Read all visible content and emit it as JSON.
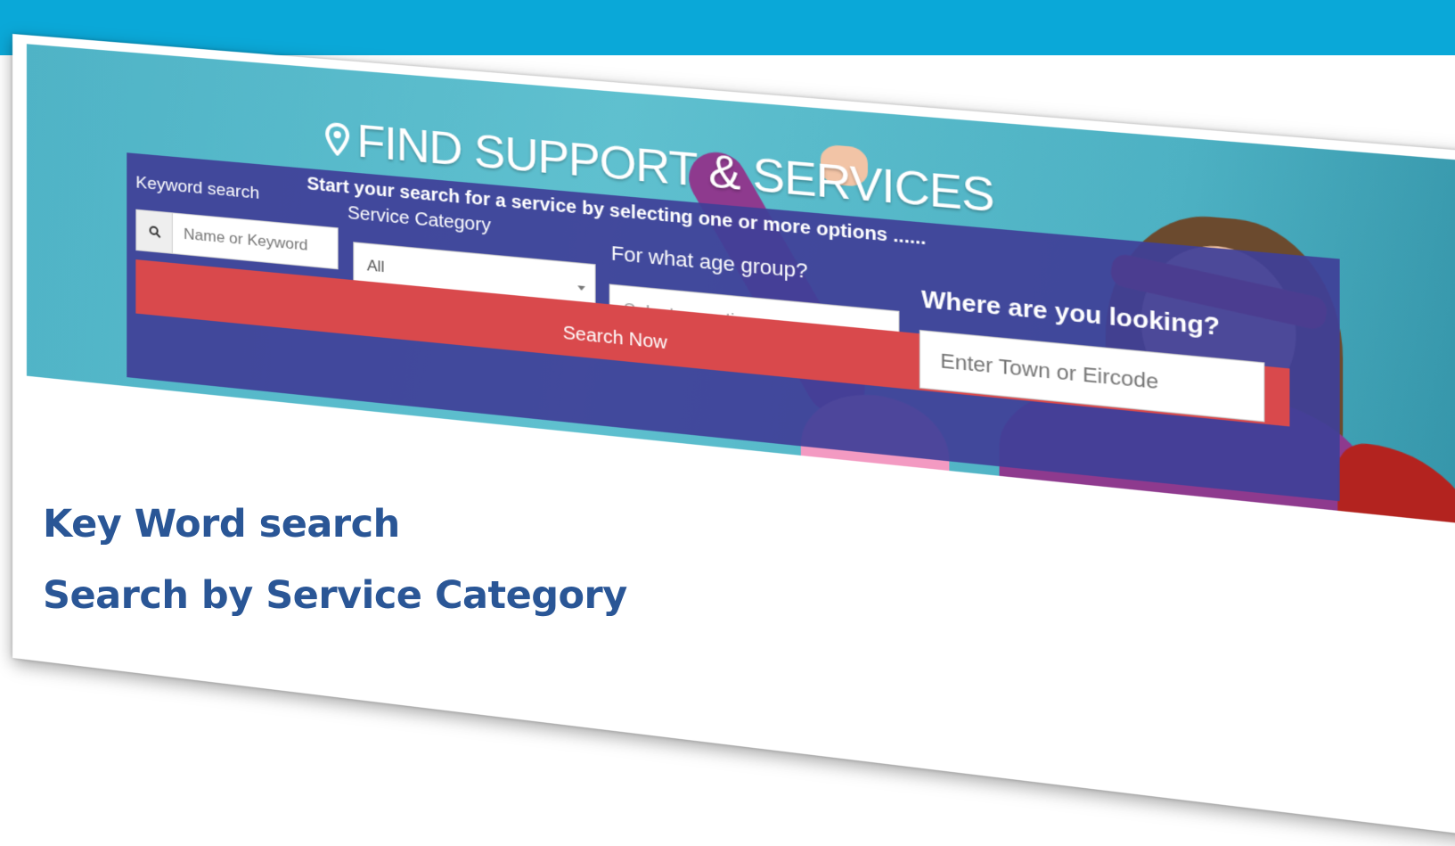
{
  "banner": {
    "title": "FIND SUPPORT & SERVICES",
    "pin_icon": "map-pin-icon"
  },
  "search": {
    "intro": "Start your search for a service by selecting one or more options ......",
    "keyword_label": "Keyword search",
    "keyword_placeholder": "Name or Keyword",
    "keyword_icon": "search-icon",
    "category_label": "Service Category",
    "category_value": "All",
    "age_label": "For what age group?",
    "age_value": "Select an option",
    "where_label": "Where are you looking?",
    "where_placeholder": "Enter Town or Eircode",
    "button_label": "Search Now"
  },
  "notes": {
    "items": [
      "Key Word search",
      "Search by Service Category"
    ]
  },
  "colors": {
    "top_band": "#0aa8d8",
    "panel": "#3f3f98",
    "button": "#d9494c",
    "notes_text": "#2a5696"
  }
}
